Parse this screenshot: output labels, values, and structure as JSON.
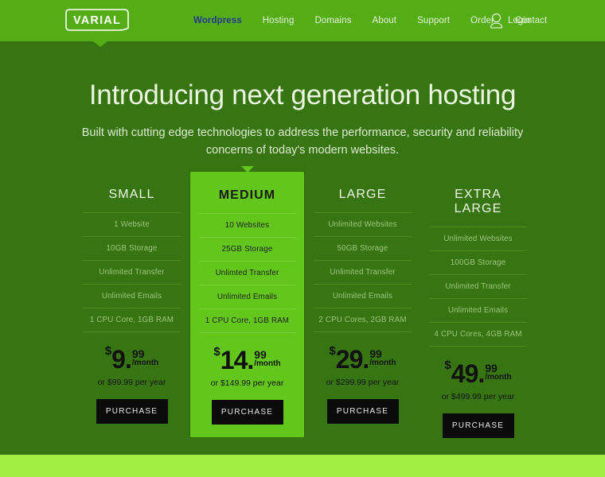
{
  "header": {
    "logo_text": "VARIAL",
    "logo_icon": "varial-logo",
    "nav": [
      {
        "label": "Wordpress",
        "active": true
      },
      {
        "label": "Hosting",
        "active": false
      },
      {
        "label": "Domains",
        "active": false
      },
      {
        "label": "About",
        "active": false
      },
      {
        "label": "Support",
        "active": false
      },
      {
        "label": "Order",
        "active": false
      },
      {
        "label": "Contact",
        "active": false
      }
    ],
    "login": {
      "label": "Login",
      "icon": "user-icon"
    },
    "colors": {
      "background": "#55ad16",
      "active_link": "#25378a",
      "link": "#e3f2d6"
    }
  },
  "hero": {
    "title": "Introducing next generation hosting",
    "subtitle": "Built with cutting edge technologies to address the performance, security and reliability concerns of today's modern websites."
  },
  "pricing": {
    "plans": [
      {
        "title": "SMALL",
        "featured": false,
        "features": [
          "1 Website",
          "10GB Storage",
          "Unlimited Transfer",
          "Unlimited Emails",
          "1 CPU Core, 1GB RAM"
        ],
        "currency": "$",
        "amount": "9",
        "dot": ".",
        "cents": "99",
        "per": "/month",
        "yearly": "or $99.99 per year",
        "button": "PURCHASE"
      },
      {
        "title": "MEDIUM",
        "featured": true,
        "features": [
          "10 Websites",
          "25GB Storage",
          "Unlimted Transfer",
          "Unlimited Emails",
          "1 CPU Core, 1GB RAM"
        ],
        "currency": "$",
        "amount": "14",
        "dot": ".",
        "cents": "99",
        "per": "/month",
        "yearly": "or $149.99 per year",
        "button": "PURCHASE"
      },
      {
        "title": "LARGE",
        "featured": false,
        "features": [
          "Unlimited Websites",
          "50GB Storage",
          "Unlimited Transfer",
          "Unlimited Emails",
          "2 CPU Cores, 2GB RAM"
        ],
        "currency": "$",
        "amount": "29",
        "dot": ".",
        "cents": "99",
        "per": "/month",
        "yearly": "or $299.99 per year",
        "button": "PURCHASE"
      },
      {
        "title": "EXTRA LARGE",
        "featured": false,
        "features": [
          "Unlimited Websites",
          "100GB Storage",
          "Unlimited Transfer",
          "Unlimited Emails",
          "4 CPU Cores, 4GB RAM"
        ],
        "currency": "$",
        "amount": "49",
        "dot": ".",
        "cents": "99",
        "per": "/month",
        "yearly": "or $499.99 per year",
        "button": "PURCHASE"
      }
    ],
    "colors": {
      "page_background": "#377512",
      "featured_background": "#63c71b",
      "button_background": "#0b0b0b",
      "footer_band": "#a2ef42"
    }
  }
}
